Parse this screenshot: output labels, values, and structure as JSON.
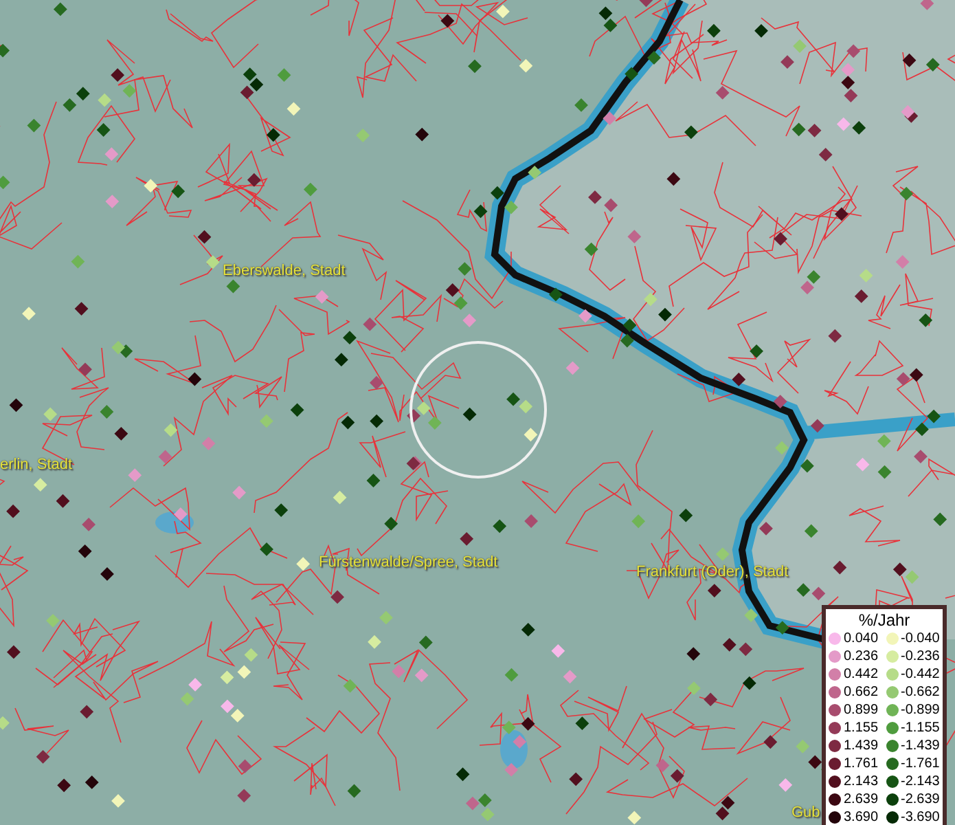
{
  "map": {
    "labels": [
      "Eberswalde, Stadt",
      "erlin, Stadt",
      "Fürstenwalde/Spree, Stadt",
      "Frankfurt (Oder), Stadt",
      "Gub"
    ]
  },
  "legend": {
    "title": "%/Jahr",
    "rows": [
      {
        "positive": {
          "label": "0.040",
          "color": "#f8b8ea"
        },
        "negative": {
          "label": "-0.040",
          "color": "#f2f5b8"
        }
      },
      {
        "positive": {
          "label": "0.236",
          "color": "#e49ac8"
        },
        "negative": {
          "label": "-0.236",
          "color": "#d6eca0"
        }
      },
      {
        "positive": {
          "label": "0.442",
          "color": "#d27fa8"
        },
        "negative": {
          "label": "-0.442",
          "color": "#b6dc88"
        }
      },
      {
        "positive": {
          "label": "0.662",
          "color": "#bf668c"
        },
        "negative": {
          "label": "-0.662",
          "color": "#95c972"
        }
      },
      {
        "positive": {
          "label": "0.899",
          "color": "#a84c6e"
        },
        "negative": {
          "label": "-0.899",
          "color": "#70b456"
        }
      },
      {
        "positive": {
          "label": "1.155",
          "color": "#943a58"
        },
        "negative": {
          "label": "-1.155",
          "color": "#4f9c3e"
        }
      },
      {
        "positive": {
          "label": "1.439",
          "color": "#7e2a42"
        },
        "negative": {
          "label": "-1.439",
          "color": "#3a842e"
        }
      },
      {
        "positive": {
          "label": "1.761",
          "color": "#6a1c30"
        },
        "negative": {
          "label": "-1.761",
          "color": "#266a20"
        }
      },
      {
        "positive": {
          "label": "2.143",
          "color": "#520f1e"
        },
        "negative": {
          "label": "-2.143",
          "color": "#165414"
        }
      },
      {
        "positive": {
          "label": "2.639",
          "color": "#3c0812"
        },
        "negative": {
          "label": "-2.639",
          "color": "#0c400c"
        }
      },
      {
        "positive": {
          "label": "3.690",
          "color": "#24040a"
        },
        "negative": {
          "label": "-3.690",
          "color": "#052a05"
        }
      }
    ]
  }
}
